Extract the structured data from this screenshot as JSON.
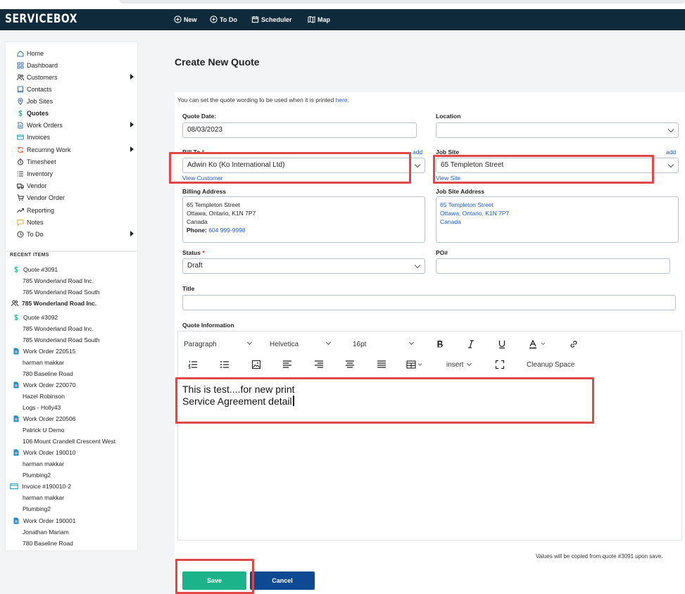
{
  "app": {
    "brand": "SERVICEBOX"
  },
  "nav": [
    {
      "label": "New",
      "icon": "plus-circle-icon"
    },
    {
      "label": "To Do",
      "icon": "plus-circle-icon"
    },
    {
      "label": "Scheduler",
      "icon": "calendar-icon"
    },
    {
      "label": "Map",
      "icon": "map-icon"
    }
  ],
  "sidebar": {
    "items": [
      {
        "label": "Home",
        "icon": "home-icon"
      },
      {
        "label": "Dashboard",
        "icon": "grid-icon"
      },
      {
        "label": "Customers",
        "icon": "users-icon",
        "submenu": true
      },
      {
        "label": "Contacts",
        "icon": "book-icon"
      },
      {
        "label": "Job Sites",
        "icon": "pin-icon"
      },
      {
        "label": "Quotes",
        "icon": "dollar-icon",
        "active": true
      },
      {
        "label": "Work Orders",
        "icon": "document-icon",
        "submenu": true
      },
      {
        "label": "Invoices",
        "icon": "invoice-icon"
      },
      {
        "label": "Recurring Work",
        "icon": "recurring-icon",
        "submenu": true
      },
      {
        "label": "Timesheet",
        "icon": "timer-icon"
      },
      {
        "label": "Inventory",
        "icon": "list-icon"
      },
      {
        "label": "Vendor",
        "icon": "truck-icon"
      },
      {
        "label": "Vendor Order",
        "icon": "cart-icon"
      },
      {
        "label": "Reporting",
        "icon": "trend-icon"
      },
      {
        "label": "Notes",
        "icon": "note-icon"
      },
      {
        "label": "To Do",
        "icon": "clock-icon",
        "submenu": true
      }
    ]
  },
  "recent": {
    "title": "RECENT ITEMS",
    "entries": [
      {
        "kind": "head",
        "label": "Quote #3091",
        "icon": "dollar-icon"
      },
      {
        "kind": "sub",
        "label": "785 Wonderland Road Inc."
      },
      {
        "kind": "sub",
        "label": "785 Wonderland Road South"
      },
      {
        "kind": "headbold",
        "label": "785 Wonderland Road Inc.",
        "icon": "users-icon"
      },
      {
        "kind": "head",
        "label": "Quote #3092",
        "icon": "dollar-icon"
      },
      {
        "kind": "sub",
        "label": "785 Wonderland Road Inc."
      },
      {
        "kind": "sub",
        "label": "785 Wonderland Road South"
      },
      {
        "kind": "head",
        "label": "Work Order 220515",
        "icon": "document-icon"
      },
      {
        "kind": "sub",
        "label": "harman makkar"
      },
      {
        "kind": "sub",
        "label": "780 Baseline Road"
      },
      {
        "kind": "head",
        "label": "Work Order 220070",
        "icon": "document-icon"
      },
      {
        "kind": "sub",
        "label": "Hazel Robinson"
      },
      {
        "kind": "sub",
        "label": "Logs - Holly43"
      },
      {
        "kind": "head",
        "label": "Work Order 220506",
        "icon": "document-icon"
      },
      {
        "kind": "sub",
        "label": "Patrick U Demo"
      },
      {
        "kind": "sub",
        "label": "106 Mount Crandell Crescent West"
      },
      {
        "kind": "head",
        "label": "Work Order 190010",
        "icon": "document-icon"
      },
      {
        "kind": "sub",
        "label": "harman makkar"
      },
      {
        "kind": "sub",
        "label": "Plumbing2"
      },
      {
        "kind": "head",
        "label": "Invoice #190010-2",
        "icon": "invoice-icon"
      },
      {
        "kind": "sub",
        "label": "harman makkar"
      },
      {
        "kind": "sub",
        "label": "Plumbing2"
      },
      {
        "kind": "head",
        "label": "Work Order 190001",
        "icon": "document-icon"
      },
      {
        "kind": "sub",
        "label": "Jonathan Mariam"
      },
      {
        "kind": "sub",
        "label": "780 Baseline Road"
      }
    ]
  },
  "page": {
    "title": "Create New Quote"
  },
  "form": {
    "info_text": "You can set the quote wording to be used when it is printed",
    "info_link": "here.",
    "quote_date_label": "Quote Date:",
    "quote_date_value": "08/03/2023",
    "location_label": "Location",
    "location_value": "",
    "bill_to_label": "Bill To",
    "required_mark": "*",
    "bill_to_add": "add",
    "bill_to_value": "Adwin Ko (Ko International Ltd)",
    "view_customer": "View Customer",
    "job_site_label": "Job Site",
    "job_site_add": "add",
    "job_site_value": "65 Templeton Street",
    "view_site": "View Site",
    "billing_address_label": "Billing Address",
    "billing_address": {
      "line1": "65 Templeton Street",
      "line2": "Ottawa, Ontario, K1N 7P7",
      "line3": "Canada",
      "phone_label": "Phone:",
      "phone": "604 999-9998"
    },
    "job_site_address_label": "Job Site Address",
    "job_site_address": {
      "line1": "65 Templeton Street",
      "line2": "Ottawa, Ontario, K1N 7P7",
      "line3": "Canada"
    },
    "status_label": "Status",
    "status_value": "Draft",
    "po_label": "PO#",
    "po_value": "",
    "title_label": "Title",
    "title_value": "",
    "quote_info_label": "Quote Information"
  },
  "editor": {
    "block_format": "Paragraph",
    "font_family": "Helvetica",
    "font_size": "16pt",
    "insert_label": "insert",
    "cleanup_label": "Cleanup Space",
    "content_line1": "This is test....for new print",
    "content_line2": "Service Agreement detail"
  },
  "footer": {
    "note": "Values will be copied from quote #3091 upon save.",
    "save_label": "Save",
    "cancel_label": "Cancel"
  },
  "colors": {
    "navbar": "#0f2a3a",
    "accent_link": "#1f5bd6",
    "save": "#1db38a",
    "cancel": "#0d4a93",
    "highlight": "#e04848"
  }
}
